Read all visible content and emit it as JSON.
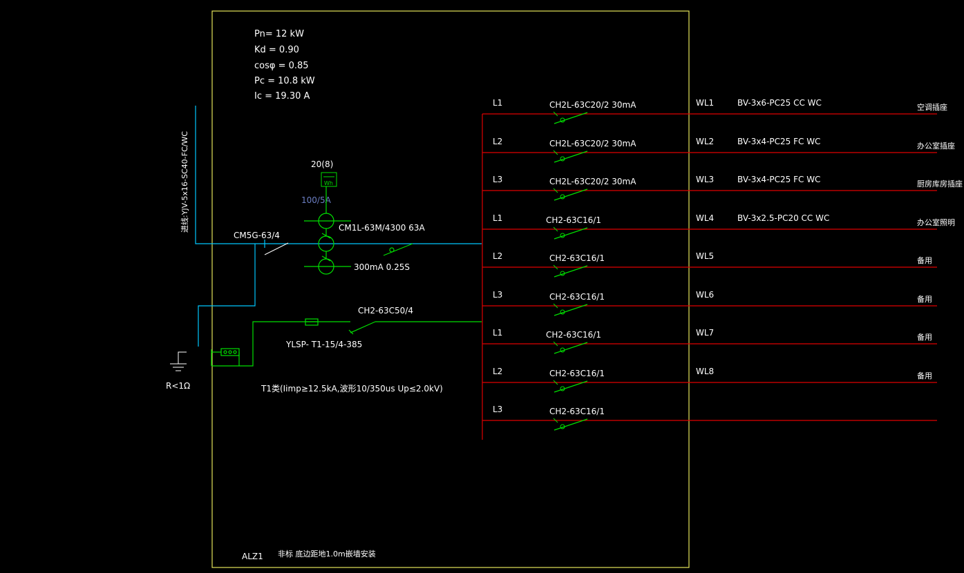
{
  "load": {
    "pn": "Pn= 12  kW",
    "kd": "Kd  = 0.90",
    "cos": "cosφ  = 0.85",
    "pc": "Pc  = 10.8  kW",
    "ic": "Ic  = 19.30  A"
  },
  "incoming": {
    "cable": "进线:YJV-5x16-SC40-FC/WC",
    "isolator": "CM5G-63/4",
    "meter": "20(8)",
    "meter_symbol": "Wh",
    "ct": "100/5A",
    "main_breaker": "CM1L-63M/4300  63A",
    "rcd": "300mA   0.25S",
    "spd_breaker": "CH2-63C50/4",
    "spd": "YLSP- T1-15/4-385",
    "spd_note": "T1类(Iimp≥12.5kA,波形10/350us  Up≤2.0kV)",
    "ground": "R<1Ω"
  },
  "circuits": [
    {
      "phase": "L1",
      "breaker": "CH2L-63C20/2  30mA",
      "wl": "WL1",
      "cable": "BV-3x6-PC25    CC  WC",
      "use": "空调插座"
    },
    {
      "phase": "L2",
      "breaker": "CH2L-63C20/2  30mA",
      "wl": "WL2",
      "cable": "BV-3x4-PC25    FC  WC",
      "use": "办公室插座"
    },
    {
      "phase": "L3",
      "breaker": "CH2L-63C20/2  30mA",
      "wl": "WL3",
      "cable": "BV-3x4-PC25    FC  WC",
      "use": "厨房库房插座"
    },
    {
      "phase": "L1",
      "breaker": "CH2-63C16/1",
      "wl": "WL4",
      "cable": "BV-3x2.5-PC20    CC  WC",
      "use": "办公室照明"
    },
    {
      "phase": "L2",
      "breaker": "CH2-63C16/1",
      "wl": "WL5",
      "cable": "",
      "use": "备用"
    },
    {
      "phase": "L3",
      "breaker": "CH2-63C16/1",
      "wl": "WL6",
      "cable": "",
      "use": "备用"
    },
    {
      "phase": "L1",
      "breaker": "CH2-63C16/1",
      "wl": "WL7",
      "cable": "",
      "use": "备用"
    },
    {
      "phase": "L2",
      "breaker": "CH2-63C16/1",
      "wl": "WL8",
      "cable": "",
      "use": "备用"
    },
    {
      "phase": "L3",
      "breaker": "CH2-63C16/1",
      "wl": "",
      "cable": "",
      "use": ""
    }
  ],
  "footer": {
    "panel_id": "ALZ1",
    "note": "非标  底边距地1.0m嵌墙安装"
  },
  "colors": {
    "frame": "#e4e45a",
    "incoming_line": "#00c8ff",
    "green_line": "#00e000",
    "red_line": "#e00000",
    "text": "#ffffff"
  }
}
